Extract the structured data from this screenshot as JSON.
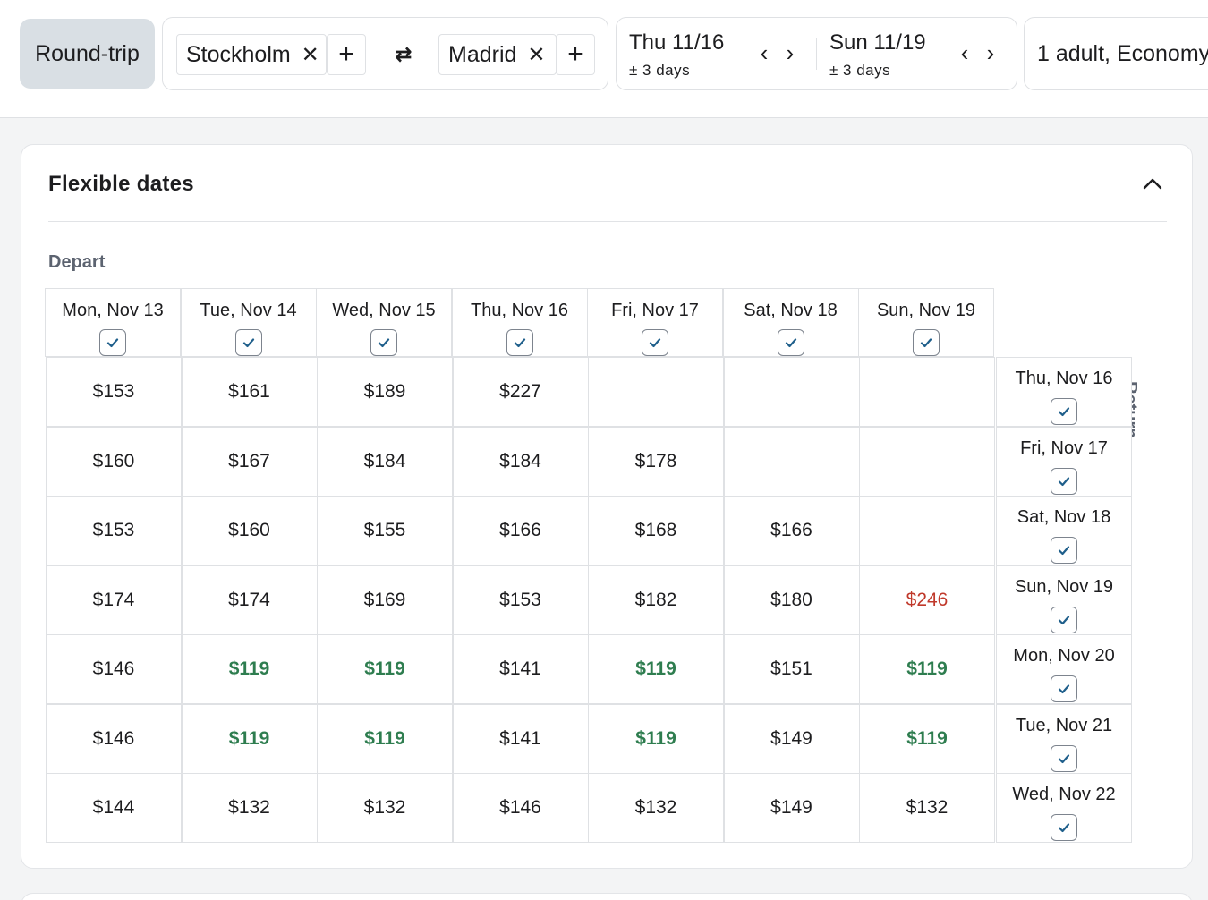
{
  "search": {
    "trip_type": "Round-trip",
    "origin": "Stockholm",
    "destination": "Madrid",
    "remove_glyph": "✕",
    "add_glyph": "+",
    "swap_glyph": "⇄",
    "depart_date": "Thu 11/16",
    "depart_flex": "± 3 days",
    "return_date": "Sun 11/19",
    "return_flex": "± 3 days",
    "prev_glyph": "‹",
    "next_glyph": "›",
    "passengers": "1 adult, Economy"
  },
  "flex": {
    "title": "Flexible dates",
    "depart_label": "Depart",
    "return_label": "Return",
    "depart_dates": [
      "Mon, Nov 13",
      "Tue, Nov 14",
      "Wed, Nov 15",
      "Thu, Nov 16",
      "Fri, Nov 17",
      "Sat, Nov 18",
      "Sun, Nov 19"
    ],
    "return_dates": [
      "Thu, Nov 16",
      "Fri, Nov 17",
      "Sat, Nov 18",
      "Sun, Nov 19",
      "Mon, Nov 20",
      "Tue, Nov 21",
      "Wed, Nov 22"
    ],
    "prices": [
      [
        "$153",
        "$161",
        "$189",
        "$227",
        "",
        "",
        ""
      ],
      [
        "$160",
        "$167",
        "$184",
        "$184",
        "$178",
        "",
        ""
      ],
      [
        "$153",
        "$160",
        "$155",
        "$166",
        "$168",
        "$166",
        ""
      ],
      [
        "$174",
        "$174",
        "$169",
        "$153",
        "$182",
        "$180",
        "$246"
      ],
      [
        "$146",
        "$119",
        "$119",
        "$141",
        "$119",
        "$151",
        "$119"
      ],
      [
        "$146",
        "$119",
        "$119",
        "$141",
        "$119",
        "$149",
        "$119"
      ],
      [
        "$144",
        "$132",
        "$132",
        "$146",
        "$132",
        "$149",
        "$132"
      ]
    ],
    "lowest_price": "$119",
    "highest_price": "$246",
    "colors": {
      "low": "#2e7d4f",
      "high": "#c0392b",
      "check": "#1f5f8b"
    }
  }
}
